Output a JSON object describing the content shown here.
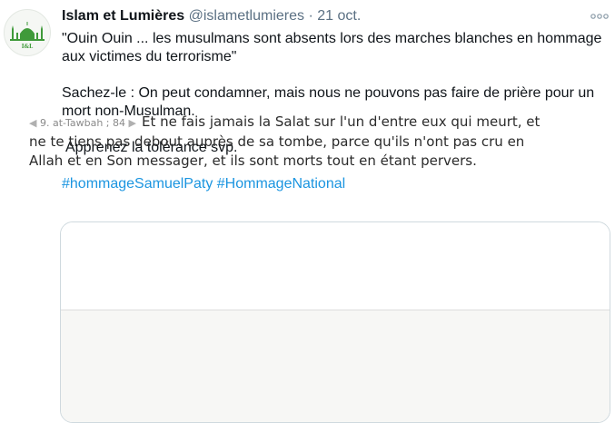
{
  "tweet": {
    "display_name": "Islam et Lumières",
    "handle": "@islametlumieres",
    "separator": "·",
    "timestamp": "21 oct.",
    "avatar_text": "I&L",
    "paragraphs": [
      "\"Ouin Ouin ... les musulmans sont absents lors des marches blanches en hommage aux victimes du terrorisme\"",
      "Sachez-le : On peut condamner, mais nous ne pouvons pas faire de prière pour un mort non-Musulman.",
      "Apprenez la tolérance svp."
    ],
    "hashtags": [
      "#hommageSamuelPaty",
      "#HommageNational"
    ]
  },
  "card": {
    "verse_reference": "9. at-Tawbah ; 84",
    "verse_text": "Et ne fais jamais la Salat sur l'un d'entre eux qui meurt, et ne te tiens pas debout auprès de sa tombe, parce qu'ils n'ont pas cru en Allah et en Son messager, et ils sont morts tout en étant pervers."
  },
  "icons": {
    "more": "more-horizontal-icon",
    "avatar_logo": "mosque-logo"
  },
  "colors": {
    "text_primary": "#0f1419",
    "text_secondary": "#5b7083",
    "link": "#1b95e0",
    "avatar_green": "#3f9a3a",
    "card_border": "#cfd9de"
  }
}
